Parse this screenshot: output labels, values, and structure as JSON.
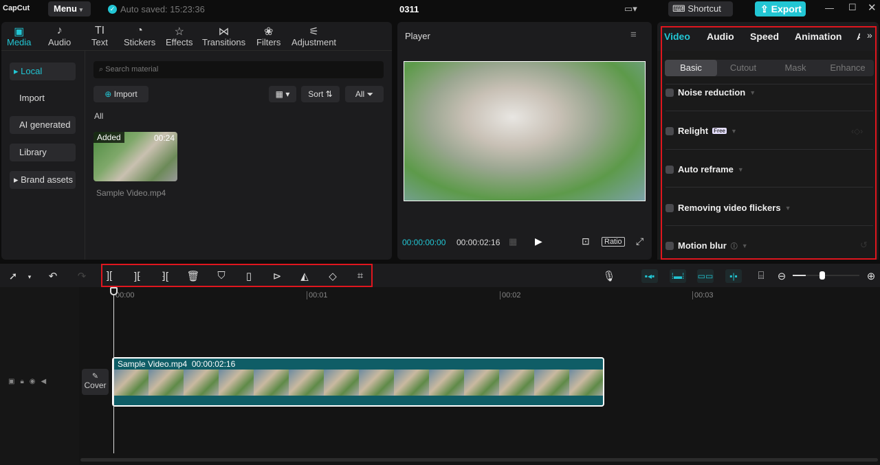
{
  "app": {
    "logo": "CapCut",
    "menu": "Menu",
    "autosave": "Auto saved: 15:23:36",
    "project": "0311",
    "shortcut": "Shortcut",
    "export": "Export"
  },
  "media_tabs": [
    {
      "label": "Media",
      "icon": "media-icon"
    },
    {
      "label": "Audio",
      "icon": "audio-icon"
    },
    {
      "label": "Text",
      "icon": "text-icon"
    },
    {
      "label": "Stickers",
      "icon": "stickers-icon"
    },
    {
      "label": "Effects",
      "icon": "effects-icon"
    },
    {
      "label": "Transitions",
      "icon": "transitions-icon"
    },
    {
      "label": "Filters",
      "icon": "filters-icon"
    },
    {
      "label": "Adjustment",
      "icon": "adjustment-icon"
    }
  ],
  "sidebar": {
    "items": [
      "Local",
      "Import",
      "AI generated",
      "Library",
      "Brand assets"
    ]
  },
  "media": {
    "search_placeholder": "Search material",
    "import": "Import",
    "sort": "Sort",
    "all_filter": "All",
    "section": "All",
    "clip": {
      "badge": "Added",
      "duration": "00:24",
      "name": "Sample Video.mp4"
    }
  },
  "player": {
    "title": "Player",
    "current": "00:00:00:00",
    "total": "00:00:02:16",
    "ratio": "Ratio"
  },
  "inspector": {
    "tabs": [
      "Video",
      "Audio",
      "Speed",
      "Animation",
      "A"
    ],
    "subtabs": [
      "Basic",
      "Cutout",
      "Mask",
      "Enhance"
    ],
    "options": [
      "Noise reduction",
      "Relight",
      "Auto reframe",
      "Removing video flickers",
      "Motion blur"
    ],
    "free_badge": "Free"
  },
  "timeline": {
    "ticks": [
      "00:00",
      "00:01",
      "00:02",
      "00:03"
    ],
    "cover": "Cover",
    "clip_name": "Sample Video.mp4",
    "clip_duration": "00:00:02:16",
    "zoom_level": 0.2
  },
  "colors": {
    "accent": "#22c6d4",
    "highlight": "#e0161e"
  }
}
